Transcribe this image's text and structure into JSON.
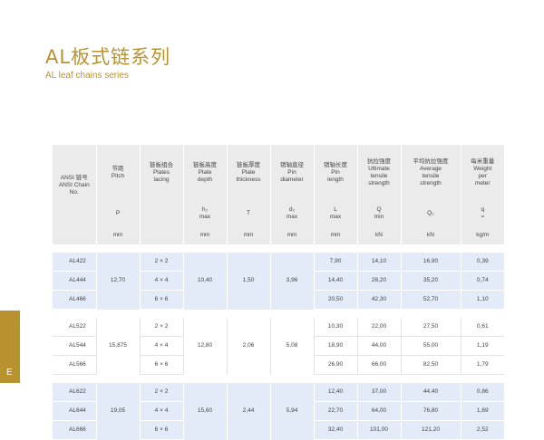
{
  "header": {
    "title_cn": "AL板式链系列",
    "title_en": "AL leaf chains series"
  },
  "side_tab": {
    "letter": "E"
  },
  "table": {
    "headers": {
      "ansi": [
        "ANSI 链号",
        "ANSI Chain",
        "No."
      ],
      "pitch": [
        "节距",
        "Pitch"
      ],
      "lacing": [
        "链板组合",
        "Plates",
        "lacing"
      ],
      "depth": [
        "链板高度",
        "Plate",
        "depth"
      ],
      "thickness": [
        "链板厚度",
        "Plate",
        "thickness"
      ],
      "pin_dia": [
        "销轴直径",
        "Pin",
        "diameter"
      ],
      "pin_len": [
        "销轴长度",
        "Pin",
        "length"
      ],
      "ult": [
        "抗拉强度",
        "Ultimate",
        "tensile",
        "strength"
      ],
      "avg": [
        "平均抗拉强度",
        "Average",
        "tensile",
        "strength"
      ],
      "weight": [
        "每米重量",
        "Weight",
        "per",
        "meter"
      ]
    },
    "symbols": {
      "pitch": "P",
      "depth": [
        "h₂",
        "max"
      ],
      "thickness": "T",
      "pin_dia": [
        "d₂",
        "max"
      ],
      "pin_len": [
        "L",
        "max"
      ],
      "ult": [
        "Q",
        "min"
      ],
      "avg": "Q₀",
      "weight": [
        "q",
        "≈"
      ]
    },
    "units": {
      "pitch": "mm",
      "depth": "mm",
      "thickness": "mm",
      "pin_dia": "mm",
      "pin_len": "mm",
      "ult": "kN",
      "avg": "kN",
      "weight": "kg/m"
    },
    "groups": [
      {
        "pitch": "12,70",
        "depth": "10,40",
        "thickness": "1,50",
        "pin_dia": "3,96",
        "rows": [
          {
            "model": "AL422",
            "lacing": "2 × 2",
            "pin_len": "7,90",
            "ult": "14,10",
            "avg": "16,90",
            "weight": "0,39"
          },
          {
            "model": "AL444",
            "lacing": "4 × 4",
            "pin_len": "14,40",
            "ult": "28,20",
            "avg": "35,20",
            "weight": "0,74"
          },
          {
            "model": "AL466",
            "lacing": "6 × 6",
            "pin_len": "20,50",
            "ult": "42,30",
            "avg": "52,70",
            "weight": "1,10"
          }
        ]
      },
      {
        "pitch": "15,875",
        "depth": "12,80",
        "thickness": "2,06",
        "pin_dia": "5,08",
        "rows": [
          {
            "model": "AL522",
            "lacing": "2 × 2",
            "pin_len": "10,30",
            "ult": "22,00",
            "avg": "27,50",
            "weight": "0,61"
          },
          {
            "model": "AL544",
            "lacing": "4 × 4",
            "pin_len": "18,90",
            "ult": "44,00",
            "avg": "55,00",
            "weight": "1,19"
          },
          {
            "model": "AL566",
            "lacing": "6 × 6",
            "pin_len": "26,90",
            "ult": "66,00",
            "avg": "82,50",
            "weight": "1,79"
          }
        ]
      },
      {
        "pitch": "19,05",
        "depth": "15,60",
        "thickness": "2,44",
        "pin_dia": "5,94",
        "rows": [
          {
            "model": "AL622",
            "lacing": "2 × 2",
            "pin_len": "12,40",
            "ult": "37,00",
            "avg": "44,40",
            "weight": "0,86"
          },
          {
            "model": "AL644",
            "lacing": "4 × 4",
            "pin_len": "22,70",
            "ult": "64,00",
            "avg": "76,80",
            "weight": "1,69"
          },
          {
            "model": "AL666",
            "lacing": "6 × 6",
            "pin_len": "32,40",
            "ult": "101,00",
            "avg": "121,20",
            "weight": "2,52"
          }
        ]
      }
    ]
  }
}
